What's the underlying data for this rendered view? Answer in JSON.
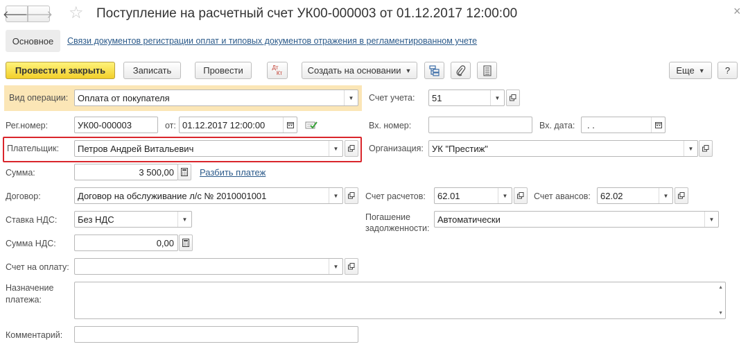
{
  "header": {
    "title": "Поступление на расчетный счет УК00-000003 от 01.12.2017 12:00:00",
    "back_icon": "arrow-left-icon",
    "forward_icon": "arrow-right-icon",
    "favorite_icon": "star-icon",
    "close_icon": "close-icon",
    "back_glyph": "🡐",
    "forward_glyph": "🡒",
    "star_glyph": "☆",
    "close_glyph": "×"
  },
  "tabs": {
    "main_label": "Основное",
    "link_label": "Связи документов регистрации оплат и типовых документов отражения в регламентированном учете"
  },
  "toolbar": {
    "post_and_close": "Провести и закрыть",
    "save": "Записать",
    "post": "Провести",
    "dtkt_top": "Дт",
    "dtkt_bottom": "Кт",
    "create_based_on": "Создать на основании",
    "more": "Еще",
    "help": "?"
  },
  "form": {
    "operation_type": {
      "label": "Вид операции:",
      "value": "Оплата от покупателя"
    },
    "account": {
      "label": "Счет учета:",
      "value": "51"
    },
    "reg_number": {
      "label": "Рег.номер:",
      "value": "УК00-000003"
    },
    "date": {
      "label": "от:",
      "value": "01.12.2017 12:00:00"
    },
    "incoming_number": {
      "label": "Вх. номер:",
      "value": ""
    },
    "incoming_date": {
      "label": "Вх. дата:",
      "value": " .  ."
    },
    "payer": {
      "label": "Плательщик:",
      "value": "Петров Андрей Витальевич"
    },
    "organization": {
      "label": "Организация:",
      "value": "УК \"Престиж\""
    },
    "amount": {
      "label": "Сумма:",
      "value": "3 500,00"
    },
    "split_payment_link": "Разбить платеж",
    "contract": {
      "label": "Договор:",
      "value": "Договор на обслуживание л/с № 2010001001"
    },
    "settlement_account": {
      "label": "Счет расчетов:",
      "value": "62.01"
    },
    "advance_account": {
      "label": "Счет авансов:",
      "value": "62.02"
    },
    "vat_rate": {
      "label": "Ставка НДС:",
      "value": "Без НДС"
    },
    "debt_repayment": {
      "label_line1": "Погашение",
      "label_line2": "задолженности:",
      "value": "Автоматически"
    },
    "vat_amount": {
      "label": "Сумма НДС:",
      "value": "0,00"
    },
    "invoice": {
      "label": "Счет на оплату:",
      "value": ""
    },
    "purpose": {
      "label_line1": "Назначение",
      "label_line2": "платежа:",
      "value": ""
    },
    "comment": {
      "label": "Комментарий:",
      "value": ""
    }
  },
  "colors": {
    "highlight": "#fbe6b6",
    "primary_button": "#f2cf2a",
    "red_outline": "#d9252b",
    "link": "#2b5a8a"
  }
}
